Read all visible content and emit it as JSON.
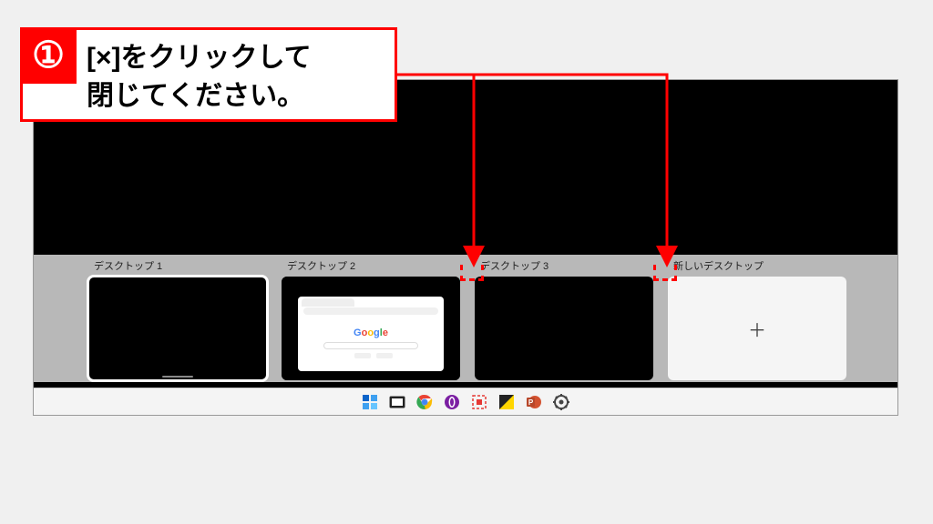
{
  "annotation": {
    "step_number": "①",
    "text": "[×]をクリックして\n閉じてください。"
  },
  "virtual_desktops": [
    {
      "label": "デスクトップ 1",
      "selected": true,
      "content": "empty"
    },
    {
      "label": "デスクトップ 2",
      "selected": false,
      "content": "browser",
      "browser_logo": "Google"
    },
    {
      "label": "デスクトップ 3",
      "selected": false,
      "content": "empty"
    }
  ],
  "new_desktop_label": "新しいデスクトップ",
  "taskbar_icons": [
    "start-icon",
    "task-view-icon",
    "chrome-icon",
    "opera-icon",
    "snip-icon",
    "editor-icon",
    "powerpoint-icon",
    "settings-icon"
  ],
  "colors": {
    "accent": "#ff0000"
  }
}
